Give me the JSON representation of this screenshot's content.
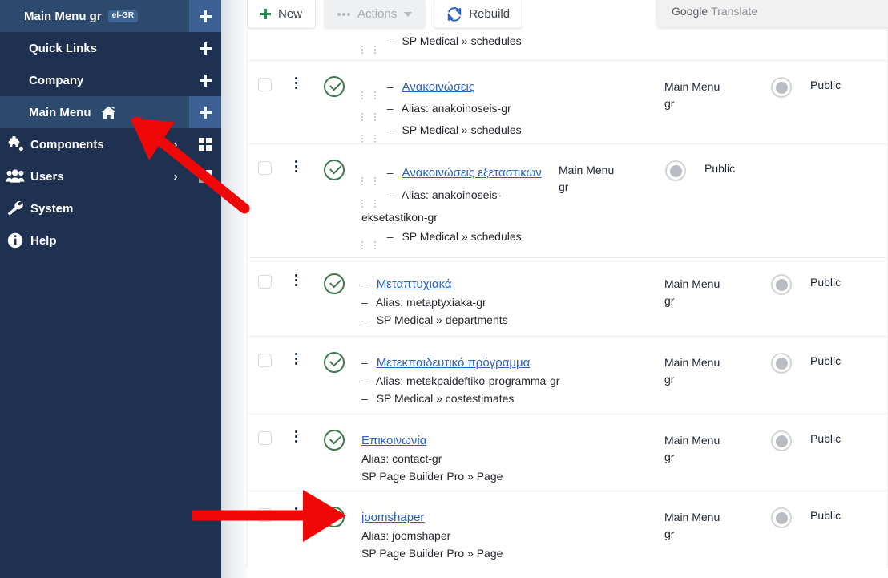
{
  "colors": {
    "sidebar_bg": "#1f3150",
    "sidebar_active": "#2e496e",
    "plus_active": "#3d6193",
    "accent_link": "#2a62c4",
    "status_green": "#3c7a4b",
    "new_plus_green": "#268e4c",
    "rebuild_blue": "#2a62c4",
    "annotation_red": "#f00808"
  },
  "sidebar": {
    "menus": [
      {
        "label": "Main Menu gr",
        "badge": "el-GR",
        "active": true,
        "add_icon": "plus-icon"
      },
      {
        "label": "Quick Links",
        "badge": "",
        "active": false,
        "add_icon": "plus-icon"
      },
      {
        "label": "Company",
        "badge": "",
        "active": false,
        "add_icon": "plus-icon"
      },
      {
        "label": "Main Menu",
        "badge": "",
        "active": true,
        "home": true,
        "add_icon": "plus-icon"
      }
    ],
    "nav": [
      {
        "label": "Components",
        "icon": "puzzle-icon",
        "chevron": "›",
        "right_icon": "grid-icon"
      },
      {
        "label": "Users",
        "icon": "users-icon",
        "chevron": "›",
        "right_icon": "grid-partial-icon"
      },
      {
        "label": "System",
        "icon": "wrench-icon",
        "chevron": "",
        "right_icon": ""
      },
      {
        "label": "Help",
        "icon": "info-icon",
        "chevron": "",
        "right_icon": ""
      }
    ]
  },
  "toolbar": {
    "new_label": "New",
    "actions_label": "Actions",
    "rebuild_label": "Rebuild"
  },
  "translate_widget": {
    "brand": "Google",
    "word": "Translate"
  },
  "table": {
    "rows": [
      {
        "clipped": true,
        "title": "",
        "title_is_link": false,
        "alias": "",
        "source": "SP Medical » schedules",
        "menu": "",
        "public": "",
        "indented": true
      },
      {
        "clipped": false,
        "title": "Ανακοινώσεις",
        "title_is_link": true,
        "alias": "Alias: anakoinoseis-gr",
        "source": "SP Medical » schedules",
        "menu_line1": "Main Menu",
        "menu_line2": "gr",
        "public": "Public",
        "indented": true
      },
      {
        "clipped": false,
        "title": "Ανακοινώσεις εξεταστικών",
        "title_is_link": true,
        "alias": "Alias: anakoinoseis-eksetastikon-gr",
        "source": "SP Medical » schedules",
        "menu_line1": "Main Menu",
        "menu_line2": "gr",
        "public": "Public",
        "indented": true
      },
      {
        "clipped": false,
        "title": "Μεταπτυχιακά",
        "title_is_link": true,
        "alias": "Alias: metaptyxiaka-gr",
        "source": "SP Medical » departments",
        "menu_line1": "Main Menu",
        "menu_line2": "gr",
        "public": "Public",
        "indented": false
      },
      {
        "clipped": false,
        "title": "Μετεκπαιδευτικό πρόγραμμα",
        "title_is_link": true,
        "alias": "Alias: metekpaideftiko-programma-gr",
        "source": "SP Medical » costestimates",
        "menu_line1": "Main Menu",
        "menu_line2": "gr",
        "public": "Public",
        "indented": false
      },
      {
        "clipped": false,
        "title": "Επικοινωνία",
        "title_is_link": true,
        "alias": "Alias: contact-gr",
        "source": "SP Page Builder Pro » Page",
        "menu_line1": "Main Menu",
        "menu_line2": "gr",
        "public": "Public",
        "indented": false,
        "no_dash": true
      },
      {
        "clipped": false,
        "title": "joomshaper",
        "title_is_link": true,
        "alias": "Alias: joomshaper",
        "source": "SP Page Builder Pro » Page",
        "menu_line1": "Main Menu",
        "menu_line2": "gr",
        "public": "Public",
        "indented": false,
        "no_dash": true
      }
    ]
  },
  "annotations": [
    {
      "name": "arrow-pointing-to-main-menu",
      "type": "arrow-up-left"
    },
    {
      "name": "arrow-pointing-to-joomshaper-status",
      "type": "arrow-right"
    }
  ]
}
